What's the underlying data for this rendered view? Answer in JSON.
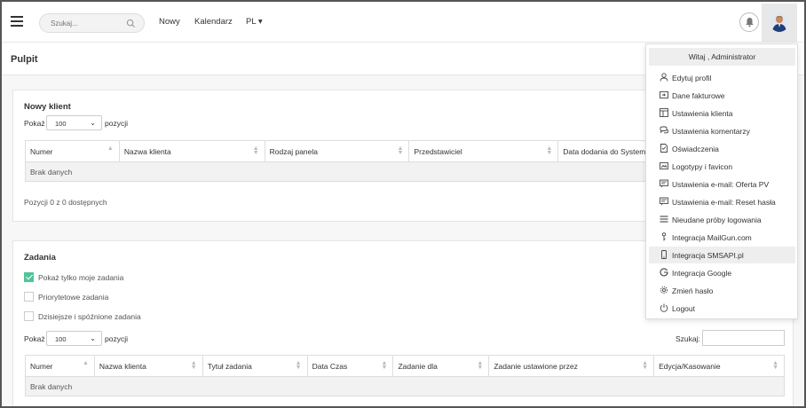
{
  "topbar": {
    "search_placeholder": "Szukaj...",
    "nav": [
      "Nowy",
      "Kalendarz",
      "PL ▾"
    ]
  },
  "page": {
    "title": "Pulpit"
  },
  "new_client": {
    "title": "Nowy klient",
    "show_label": "Pokaż",
    "page_size": "100",
    "entries_label": "pozycji",
    "columns": [
      "Numer",
      "Nazwa klienta",
      "Rodzaj panela",
      "Przedstawiciel",
      "Data dodania do System"
    ],
    "empty": "Brak danych",
    "info": "Pozycji 0 z 0 dostępnych"
  },
  "tasks": {
    "title": "Zadania",
    "checkboxes": [
      {
        "label": "Pokaż tylko moje zadania",
        "checked": true
      },
      {
        "label": "Priorytetowe zadania",
        "checked": false
      },
      {
        "label": "Dzisiejsze i spóźnione zadania",
        "checked": false
      }
    ],
    "show_label": "Pokaż",
    "page_size": "100",
    "entries_label": "pozycji",
    "search_label": "Szukaj:",
    "columns": [
      "Numer",
      "Nazwa klienta",
      "Tytuł zadania",
      "Data Czas",
      "Zadanie dla",
      "Zadanie ustawione przez",
      "Edycja/Kasowanie"
    ],
    "empty": "Brak danych"
  },
  "dropdown": {
    "greeting": "Witaj , Administrator",
    "items": [
      {
        "label": "Edytuj profil",
        "icon": "user-icon"
      },
      {
        "label": "Dane fakturowe",
        "icon": "invoice-icon"
      },
      {
        "label": "Ustawienia klienta",
        "icon": "layout-icon"
      },
      {
        "label": "Ustawienia komentarzy",
        "icon": "comments-icon"
      },
      {
        "label": "Oświadczenia",
        "icon": "document-icon"
      },
      {
        "label": "Logotypy i favicon",
        "icon": "image-icon"
      },
      {
        "label": "Ustawienia e-mail: Oferta PV",
        "icon": "email-icon"
      },
      {
        "label": "Ustawienia e-mail: Reset hasła",
        "icon": "email-icon"
      },
      {
        "label": "Nieudane próby logowania",
        "icon": "list-icon"
      },
      {
        "label": "Integracja MailGun.com",
        "icon": "key-icon"
      },
      {
        "label": "Integracja SMSAPI.pl",
        "icon": "phone-icon"
      },
      {
        "label": "Integracja Google",
        "icon": "google-icon"
      },
      {
        "label": "Zmień hasło",
        "icon": "gear-icon"
      },
      {
        "label": "Logout",
        "icon": "power-icon"
      }
    ],
    "active_index": 10
  }
}
